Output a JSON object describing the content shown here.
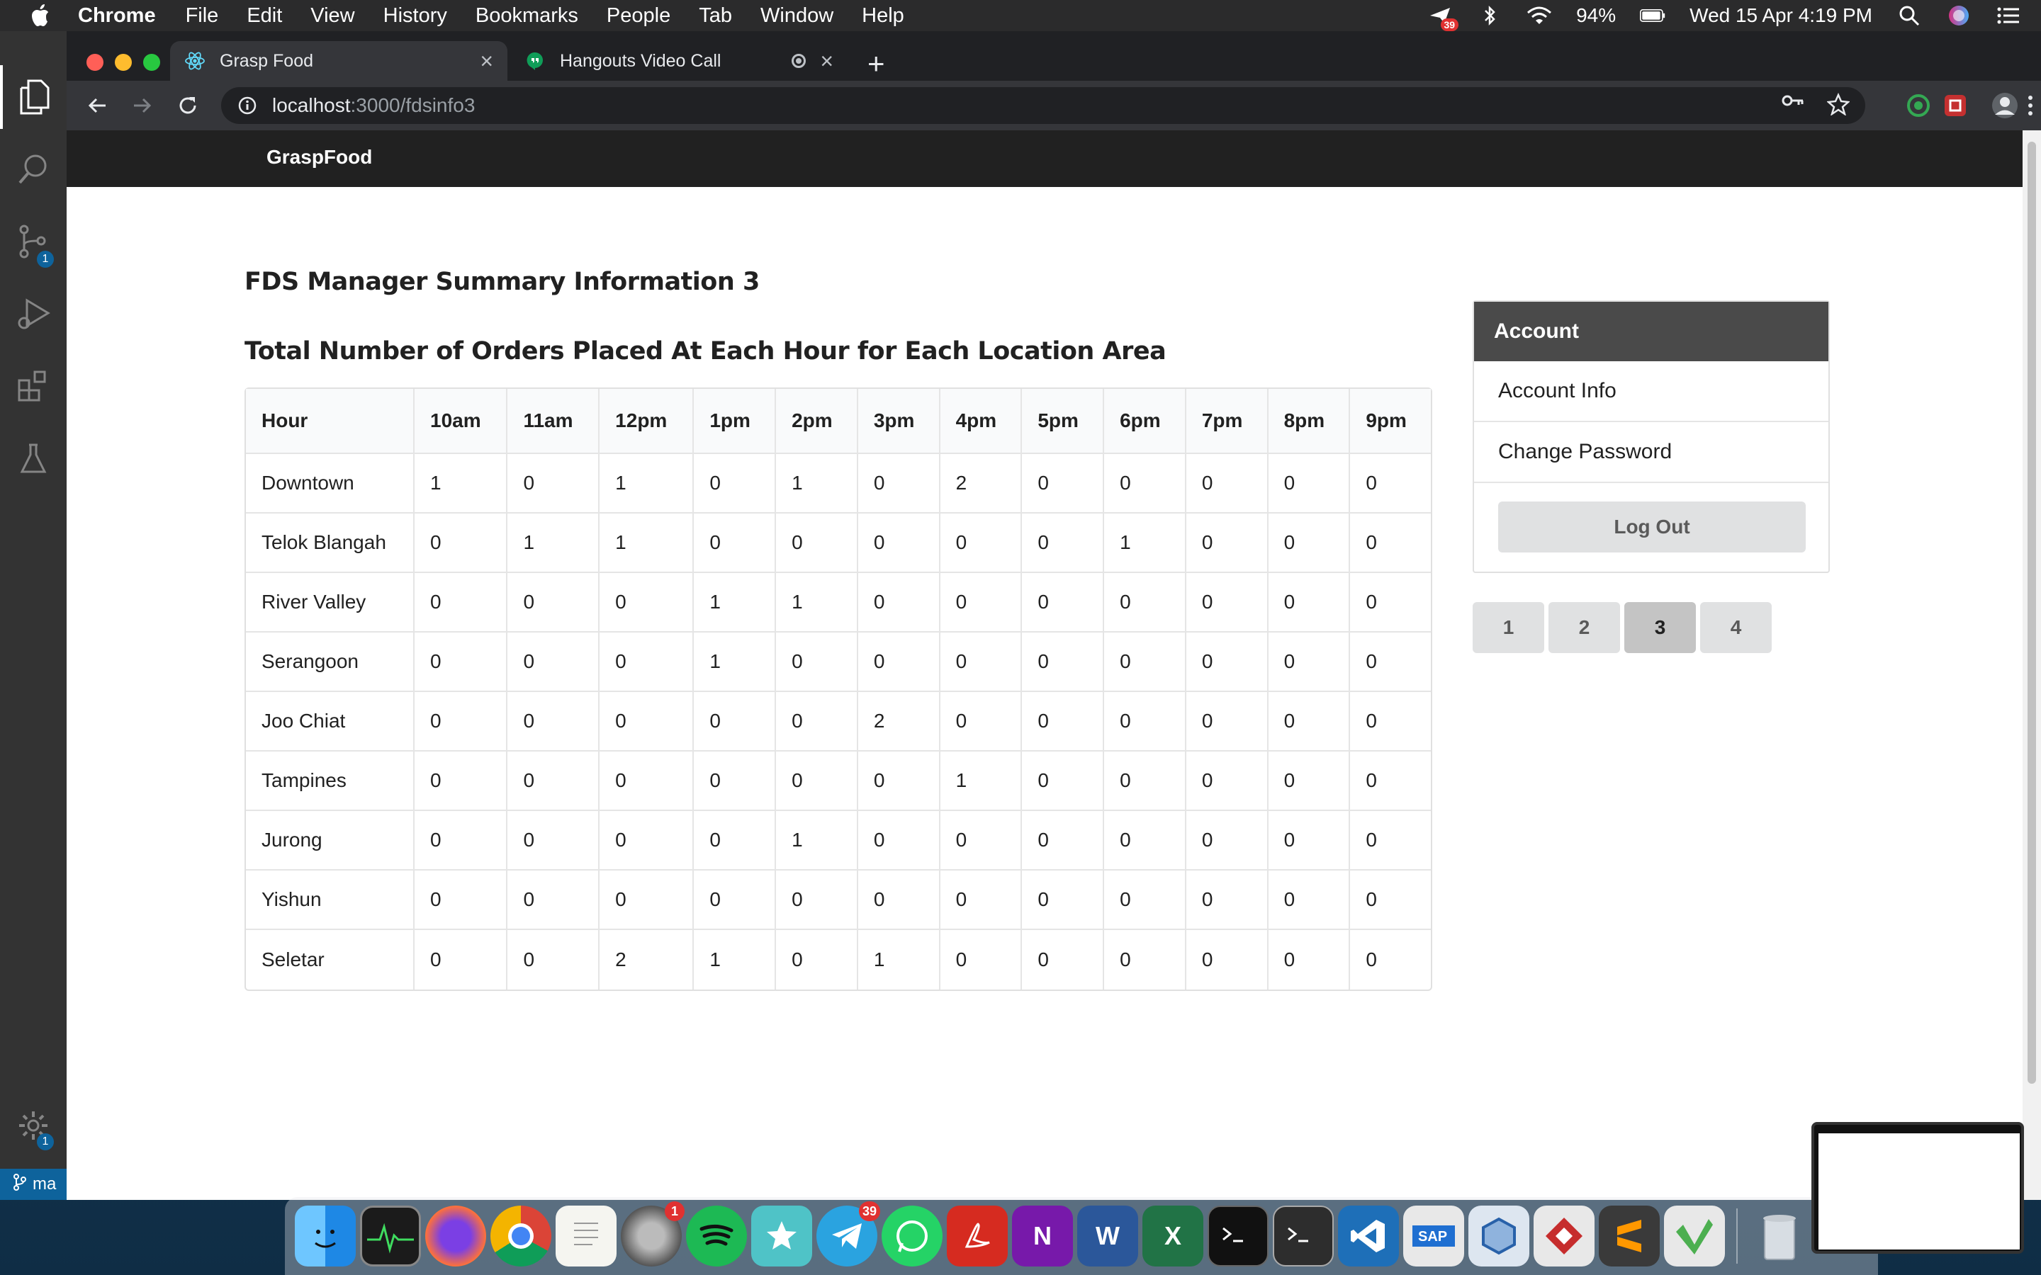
{
  "menubar": {
    "app_name": "Chrome",
    "items": [
      "File",
      "Edit",
      "View",
      "History",
      "Bookmarks",
      "People",
      "Tab",
      "Window",
      "Help"
    ],
    "battery": "94%",
    "datetime": "Wed 15 Apr  4:19 PM",
    "notification_count": "39"
  },
  "vscode": {
    "scm_badge": "1",
    "settings_badge": "1",
    "branch": "ma"
  },
  "browser": {
    "tabs": [
      {
        "title": "Grasp Food"
      },
      {
        "title": "Hangouts Video Call"
      }
    ],
    "url_host": "localhost",
    "url_path": ":3000/fdsinfo3"
  },
  "page": {
    "brand": "GraspFood",
    "title": "FDS Manager Summary Information 3",
    "table_title": "Total Number of Orders Placed At Each Hour for Each Location Area",
    "table": {
      "headers": [
        "Hour",
        "10am",
        "11am",
        "12pm",
        "1pm",
        "2pm",
        "3pm",
        "4pm",
        "5pm",
        "6pm",
        "7pm",
        "8pm",
        "9pm"
      ],
      "rows": [
        [
          "Downtown",
          "1",
          "0",
          "1",
          "0",
          "1",
          "0",
          "2",
          "0",
          "0",
          "0",
          "0",
          "0"
        ],
        [
          "Telok Blangah",
          "0",
          "1",
          "1",
          "0",
          "0",
          "0",
          "0",
          "0",
          "1",
          "0",
          "0",
          "0"
        ],
        [
          "River Valley",
          "0",
          "0",
          "0",
          "1",
          "1",
          "0",
          "0",
          "0",
          "0",
          "0",
          "0",
          "0"
        ],
        [
          "Serangoon",
          "0",
          "0",
          "0",
          "1",
          "0",
          "0",
          "0",
          "0",
          "0",
          "0",
          "0",
          "0"
        ],
        [
          "Joo Chiat",
          "0",
          "0",
          "0",
          "0",
          "0",
          "2",
          "0",
          "0",
          "0",
          "0",
          "0",
          "0"
        ],
        [
          "Tampines",
          "0",
          "0",
          "0",
          "0",
          "0",
          "0",
          "1",
          "0",
          "0",
          "0",
          "0",
          "0"
        ],
        [
          "Jurong",
          "0",
          "0",
          "0",
          "0",
          "1",
          "0",
          "0",
          "0",
          "0",
          "0",
          "0",
          "0"
        ],
        [
          "Yishun",
          "0",
          "0",
          "0",
          "0",
          "0",
          "0",
          "0",
          "0",
          "0",
          "0",
          "0",
          "0"
        ],
        [
          "Seletar",
          "0",
          "0",
          "2",
          "1",
          "0",
          "1",
          "0",
          "0",
          "0",
          "0",
          "0",
          "0"
        ]
      ]
    },
    "account": {
      "header": "Account",
      "links": [
        "Account Info",
        "Change Password"
      ],
      "logout": "Log Out"
    },
    "pagination": {
      "pages": [
        "1",
        "2",
        "3",
        "4"
      ],
      "active": "3"
    }
  },
  "dock": {
    "apps": [
      "Finder",
      "Activity Monitor",
      "Firefox",
      "Chrome",
      "TextEdit",
      "System Preferences",
      "Spotify",
      "Superstar",
      "Telegram",
      "WhatsApp",
      "Acrobat",
      "OneNote",
      "Word",
      "Excel",
      "Terminal",
      "Terminal",
      "VS Code",
      "SAP",
      "VirtualBox",
      "Git",
      "Sublime Text",
      "Vim"
    ],
    "badges": {
      "system_preferences": "1",
      "telegram": "39"
    }
  }
}
